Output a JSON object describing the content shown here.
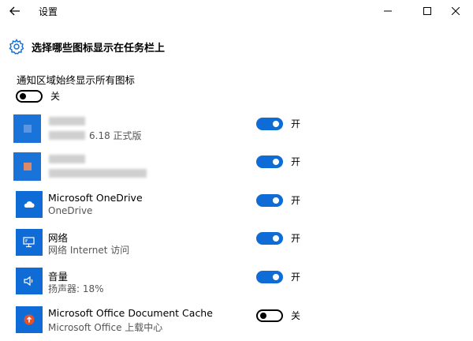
{
  "window": {
    "title": "设置"
  },
  "header": {
    "title": "选择哪些图标显示在任务栏上"
  },
  "always_show": {
    "label": "通知区域始终显示所有图标",
    "state_label": "关",
    "on": false
  },
  "apps": [
    {
      "name": "",
      "subtitle": "6.18 正式版",
      "state_label": "开",
      "on": true,
      "icon": "blurred-app-icon",
      "blurred": true
    },
    {
      "name": "",
      "subtitle": "",
      "state_label": "开",
      "on": true,
      "icon": "blurred-app-icon",
      "blurred": true
    },
    {
      "name": "Microsoft OneDrive",
      "subtitle": "OneDrive",
      "state_label": "开",
      "on": true,
      "icon": "cloud-icon"
    },
    {
      "name": "网络",
      "subtitle": "网络 Internet 访问",
      "state_label": "开",
      "on": true,
      "icon": "network-icon"
    },
    {
      "name": "音量",
      "subtitle": "扬声器: 18%",
      "state_label": "开",
      "on": true,
      "icon": "speaker-icon"
    },
    {
      "name": "Microsoft Office Document Cache",
      "subtitle": "Microsoft Office 上载中心",
      "state_label": "关",
      "on": false,
      "icon": "upload-icon"
    }
  ],
  "colors": {
    "accent": "#0f6cd6",
    "upload_badge": "#e8502a"
  }
}
